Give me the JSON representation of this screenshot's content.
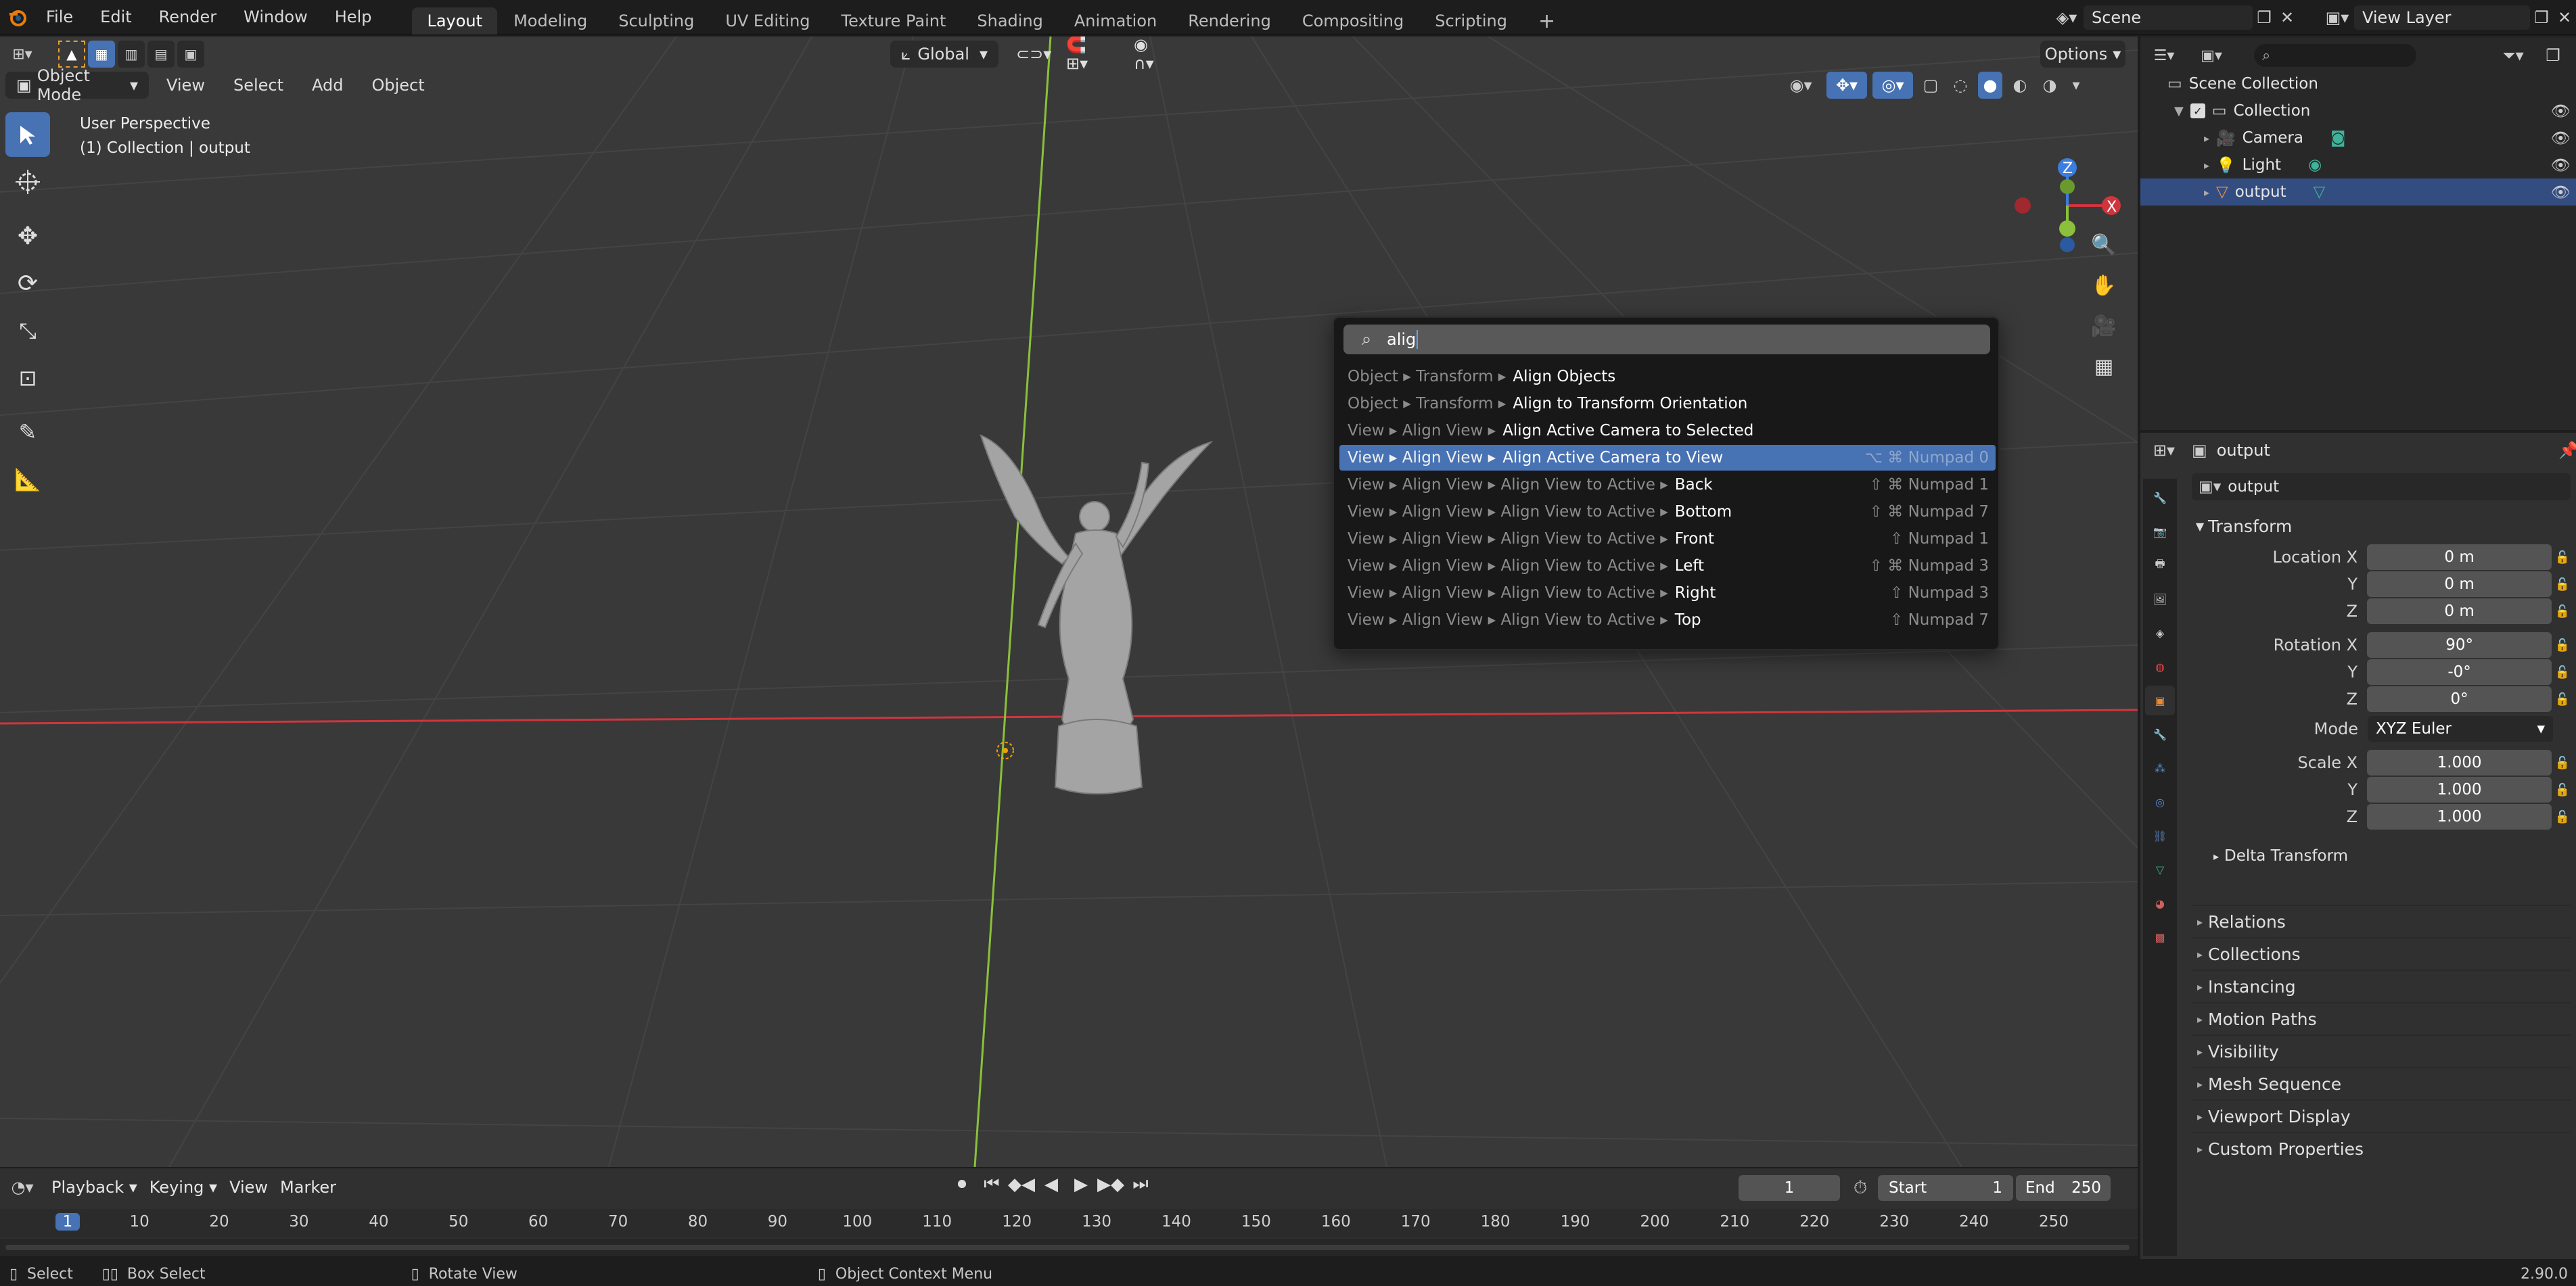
{
  "topbar": {
    "menus": [
      "File",
      "Edit",
      "Render",
      "Window",
      "Help"
    ],
    "workspaces": [
      "Layout",
      "Modeling",
      "Sculpting",
      "UV Editing",
      "Texture Paint",
      "Shading",
      "Animation",
      "Rendering",
      "Compositing",
      "Scripting"
    ],
    "active_workspace": "Layout",
    "scene": "Scene",
    "view_layer": "View Layer"
  },
  "viewport": {
    "mode": "Object Mode",
    "menus": [
      "View",
      "Select",
      "Add",
      "Object"
    ],
    "orientation": "Global",
    "options": "Options",
    "view_name": "User Perspective",
    "collection_info": "(1) Collection | output",
    "gizmo": {
      "x": "X",
      "y": "Y",
      "z": "Z"
    }
  },
  "search": {
    "query": "alig",
    "results": [
      {
        "path": "Object ▸ Transform ▸",
        "label": "Align Objects",
        "shortcut": ""
      },
      {
        "path": "Object ▸ Transform ▸",
        "label": "Align to Transform Orientation",
        "shortcut": ""
      },
      {
        "path": "View ▸ Align View ▸",
        "label": "Align Active Camera to Selected",
        "shortcut": ""
      },
      {
        "path": "View ▸ Align View ▸",
        "label": "Align Active Camera to View",
        "shortcut": "⌥ ⌘ Numpad 0"
      },
      {
        "path": "View ▸ Align View ▸ Align View to Active ▸",
        "label": "Back",
        "shortcut": "⇧ ⌘ Numpad 1"
      },
      {
        "path": "View ▸ Align View ▸ Align View to Active ▸",
        "label": "Bottom",
        "shortcut": "⇧ ⌘ Numpad 7"
      },
      {
        "path": "View ▸ Align View ▸ Align View to Active ▸",
        "label": "Front",
        "shortcut": "⇧ Numpad 1"
      },
      {
        "path": "View ▸ Align View ▸ Align View to Active ▸",
        "label": "Left",
        "shortcut": "⇧ ⌘ Numpad 3"
      },
      {
        "path": "View ▸ Align View ▸ Align View to Active ▸",
        "label": "Right",
        "shortcut": "⇧ Numpad 3"
      },
      {
        "path": "View ▸ Align View ▸ Align View to Active ▸",
        "label": "Top",
        "shortcut": "⇧ Numpad 7"
      }
    ],
    "selected_index": 3
  },
  "timeline": {
    "menus": [
      "Playback",
      "Keying",
      "View",
      "Marker"
    ],
    "current_frame": "1",
    "start_label": "Start",
    "start": "1",
    "end_label": "End",
    "end": "250",
    "ruler": [
      "1",
      "10",
      "20",
      "30",
      "40",
      "50",
      "60",
      "70",
      "80",
      "90",
      "100",
      "110",
      "120",
      "130",
      "140",
      "150",
      "160",
      "170",
      "180",
      "190",
      "200",
      "210",
      "220",
      "230",
      "240",
      "250"
    ]
  },
  "statusbar": {
    "select": "Select",
    "box_select": "Box Select",
    "rotate": "Rotate View",
    "context": "Object Context Menu",
    "version": "2.90.0"
  },
  "outliner": {
    "root": "Scene Collection",
    "collection": "Collection",
    "items": [
      "Camera",
      "Light",
      "output"
    ]
  },
  "properties": {
    "object_name": "output",
    "datablock": "output",
    "transform_title": "Transform",
    "location_label": "Location X",
    "location": [
      "0 m",
      "0 m",
      "0 m"
    ],
    "rotation_label": "Rotation X",
    "rotation": [
      "90°",
      "-0°",
      "0°"
    ],
    "mode_label": "Mode",
    "mode": "XYZ Euler",
    "scale_label": "Scale X",
    "scale": [
      "1.000",
      "1.000",
      "1.000"
    ],
    "axis_y": "Y",
    "axis_z": "Z",
    "delta": "Delta Transform",
    "panels": [
      "Relations",
      "Collections",
      "Instancing",
      "Motion Paths",
      "Visibility",
      "Mesh Sequence",
      "Viewport Display",
      "Custom Properties"
    ]
  },
  "colors": {
    "accent": "#4772b3",
    "x_axis": "#d0353d",
    "y_axis": "#8ac03a",
    "z_axis": "#3b7de0"
  }
}
